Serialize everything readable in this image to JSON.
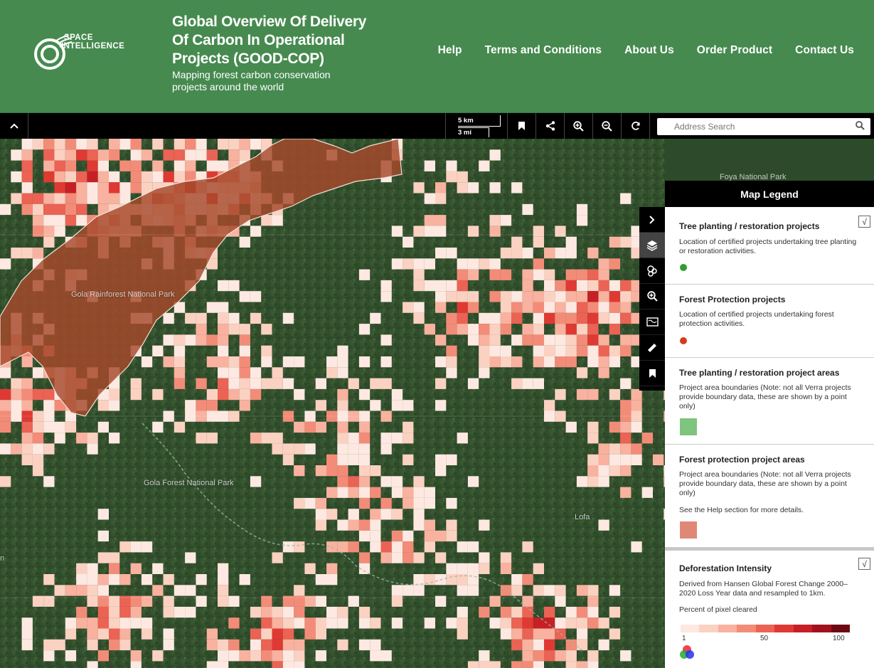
{
  "header": {
    "logo_text_line1": "SPACE",
    "logo_text_line2": "INTELLIGENCE",
    "title": "Global Overview Of Delivery Of Carbon In Operational Projects (GOOD-COP)",
    "subtitle": "Mapping forest carbon conservation projects around the world",
    "nav": [
      "Help",
      "Terms and Conditions",
      "About Us",
      "Order Product",
      "Contact Us"
    ]
  },
  "toolbar": {
    "scale_km": "5 km",
    "scale_mi": "3 mi",
    "search_placeholder": "Address Search",
    "icons": [
      "collapse-icon",
      "bookmark-icon",
      "share-icon",
      "zoom-in-icon",
      "zoom-out-icon",
      "refresh-icon",
      "search-icon"
    ]
  },
  "map": {
    "labels": {
      "gola_rainforest": "Gola Rainforest National Park",
      "gola_forest": "Gola Forest National Park",
      "lofa": "Lofa",
      "foya": "Foya National Park",
      "left_edge": "n"
    }
  },
  "sidebar": {
    "icons": [
      "expand-icon",
      "layers-icon",
      "filter-icon",
      "zoom-search-icon",
      "basemap-icon",
      "measure-icon",
      "bookmark-icon"
    ]
  },
  "legend": {
    "title": "Map Legend",
    "sections": [
      {
        "heading": "Tree planting / restoration projects",
        "text": "Location of certified projects undertaking tree planting or restoration activities.",
        "color": "#2e9e2e",
        "checked": true
      },
      {
        "heading": "Forest Protection projects",
        "text": "Location of certified projects undertaking forest protection activities.",
        "color": "#d43c1e"
      },
      {
        "heading": "Tree planting / restoration project areas",
        "text": "Project area boundaries (Note: not all Verra projects provide boundary data, these are shown by a point only)",
        "color": "#7fc47f"
      },
      {
        "heading": "Forest protection project areas",
        "text": "Project area boundaries (Note: not all Verra projects provide boundary data, these are shown by a point only)",
        "note": "See the Help section for more details.",
        "color": "#e08878"
      }
    ],
    "deforestation": {
      "heading": "Deforestation Intensity",
      "text": "Derived from Hansen Global Forest Change 2000–2020 Loss Year data and resampled to 1km.",
      "sublabel": "Percent of pixel cleared",
      "ramp_min": "1",
      "ramp_mid": "50",
      "ramp_max": "100",
      "ramp_colors": [
        "#fde9e1",
        "#fbd1c2",
        "#f8b29f",
        "#f28c78",
        "#ea6354",
        "#de3a33",
        "#c52025",
        "#a2121c",
        "#6e0912"
      ],
      "checked": true
    }
  }
}
